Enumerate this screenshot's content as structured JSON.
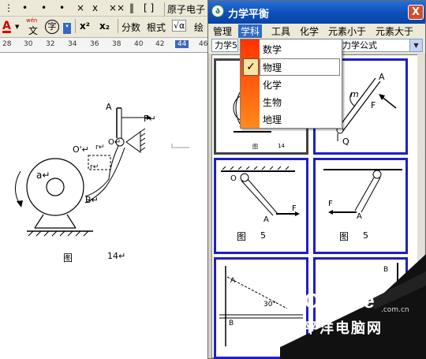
{
  "word": {
    "toolbar1": {
      "items": [
        "⋮",
        "•",
        "×",
        "ⅹ",
        "××",
        "‖",
        "[ ]",
        "原子电子"
      ]
    },
    "toolbar2": {
      "font_color_label": "A",
      "phonetic_top": "wén",
      "phonetic_char": "文",
      "enclose_char": "字",
      "superscript": "x²",
      "subscript": "x₂",
      "fraction": "分数",
      "radical": "根式",
      "sqrt_icon": "√α",
      "draw": "绘"
    },
    "ruler": [
      "28",
      "30",
      "32",
      "34",
      "36",
      "38",
      "40",
      "42",
      "44",
      "46"
    ],
    "ruler_highlight": "44",
    "figure": {
      "labels": {
        "A": "A",
        "F": "F↵",
        "O": "O↵",
        "O2": "O'↵",
        "r": "r↵",
        "r2": "r↵",
        "a": "a↵",
        "B": "B↵"
      },
      "caption_left": "图",
      "caption_num": "14↵"
    }
  },
  "app": {
    "title": "力学平衡",
    "close": "X",
    "menu": [
      "管理",
      "学科",
      "工具",
      "化学",
      "元素小于",
      "元素大于"
    ],
    "menu_active": "学科",
    "combo_left": "力学5",
    "combo_right": "力学公式",
    "dropdown": {
      "items": [
        "数学",
        "物理",
        "化学",
        "生物",
        "地理"
      ],
      "checked": "物理",
      "check_mark": "✓"
    },
    "cards": [
      {
        "caption": "图",
        "num": "14"
      },
      {
        "labels": [
          "A",
          "m",
          "F",
          "Q"
        ]
      },
      {
        "labels": [
          "O",
          "A",
          "F"
        ],
        "caption": "图",
        "num": "5"
      },
      {
        "labels": [
          "F",
          "A"
        ],
        "caption": "图",
        "num": "5"
      },
      {
        "labels": [
          "A",
          "30°",
          "B"
        ]
      },
      {
        "labels": [
          "B"
        ]
      }
    ]
  },
  "watermark": {
    "brand": "PConline",
    "domain": ".com.cn",
    "chinese": "太平洋电脑网"
  }
}
